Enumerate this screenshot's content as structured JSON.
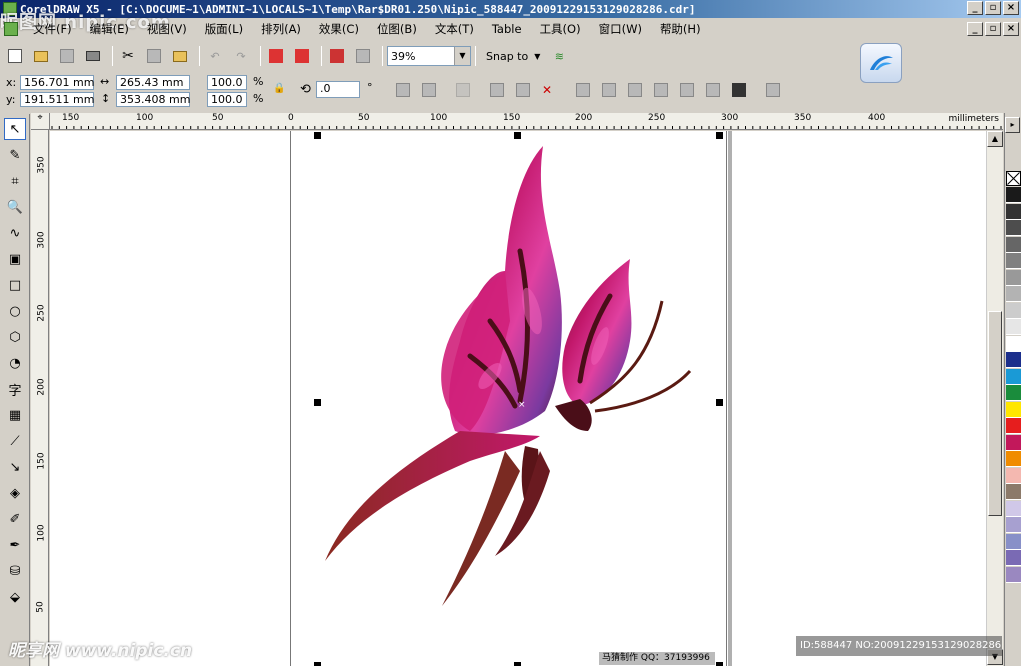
{
  "window": {
    "title": "CorelDRAW X5 - [C:\\DOCUME~1\\ADMINI~1\\LOCALS~1\\Temp\\Rar$DR01.250\\Nipic_588447_20091229153129028286.cdr]",
    "buttons": [
      "_",
      "▫",
      "×"
    ]
  },
  "menu": {
    "items": [
      "文件(F)",
      "编辑(E)",
      "视图(V)",
      "版面(L)",
      "排列(A)",
      "效果(C)",
      "位图(B)",
      "文本(T)",
      "Table",
      "工具(O)",
      "窗口(W)",
      "帮助(H)"
    ]
  },
  "toolbar": {
    "zoom_value": "39%",
    "snap_label": "Snap to"
  },
  "properties": {
    "x_label": "x:",
    "y_label": "y:",
    "x_value": "156.701 mm",
    "y_value": "191.511 mm",
    "width_value": "265.43 mm",
    "height_value": "353.408 mm",
    "scale_x": "100.0",
    "scale_y": "100.0",
    "percent": "%",
    "rotation_value": ".0",
    "degree": "°"
  },
  "rulers": {
    "units": "millimeters",
    "h_ticks": [
      "150",
      "100",
      "50",
      "0",
      "50",
      "100",
      "150",
      "200",
      "250",
      "300",
      "350",
      "400"
    ],
    "v_ticks": [
      "350",
      "300",
      "250",
      "200",
      "150",
      "100",
      "50"
    ]
  },
  "palette": {
    "colors": [
      "#1a1a1a",
      "#333333",
      "#4d4d4d",
      "#666666",
      "#808080",
      "#999999",
      "#b3b3b3",
      "#cccccc",
      "#e6e6e6",
      "#ffffff",
      "#1c2f8c",
      "#1a9ad6",
      "#1a8c3c",
      "#ffe600",
      "#e61e1e",
      "#c2185b",
      "#f08c00",
      "#f4b8b0",
      "#8c7a6a",
      "#d0c8e8",
      "#a7a0d0",
      "#8890c8",
      "#7a6ab4",
      "#9a88c0"
    ]
  },
  "watermarks": {
    "top": "昵图网 nipic.com",
    "bottom": "昵享网 www.nipic.cn",
    "id_strip": "ID:588447 NO:20091229153129028286",
    "credit": "马猜制作 QQ：37193996"
  },
  "icons": {
    "app": "coreldraw-icon",
    "logo": "coreldraw-swoosh-icon"
  }
}
